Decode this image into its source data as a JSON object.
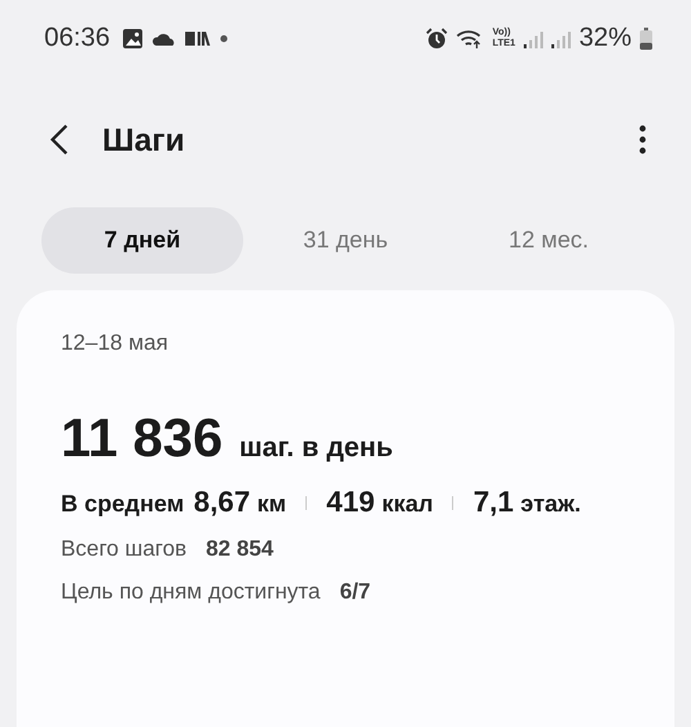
{
  "status_bar": {
    "time": "06:36",
    "volte": "Vo))",
    "lte": "LTE1",
    "battery": "32%"
  },
  "header": {
    "title": "Шаги"
  },
  "tabs": [
    {
      "label": "7 дней",
      "selected": true
    },
    {
      "label": "31 день",
      "selected": false
    },
    {
      "label": "12 мес.",
      "selected": false
    }
  ],
  "card": {
    "date_range": "12–18 мая",
    "average": {
      "value": "11 836",
      "unit": "шаг. в день"
    },
    "stats": {
      "label": "В среднем",
      "items": [
        {
          "value": "8,67",
          "unit": "км"
        },
        {
          "value": "419",
          "unit": "ккал"
        },
        {
          "value": "7,1",
          "unit": "этаж."
        }
      ]
    },
    "totals": [
      {
        "label": "Всего шагов",
        "value": "82 854"
      },
      {
        "label": "Цель по дням достигнута",
        "value": "6/7"
      }
    ]
  }
}
